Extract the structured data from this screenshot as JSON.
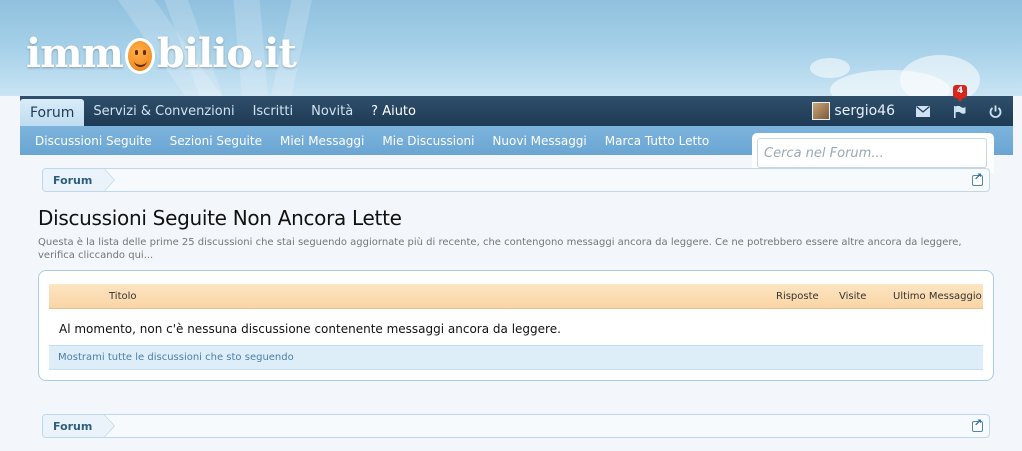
{
  "site": {
    "logo_text_left": "imm",
    "logo_text_right": "bilio.it",
    "brand_color": "#f07c10"
  },
  "nav": {
    "tabs": [
      {
        "label": "Forum",
        "active": true
      },
      {
        "label": "Servizi & Convenzioni"
      },
      {
        "label": "Iscritti"
      },
      {
        "label": "Novità"
      },
      {
        "label": "? Aiuto"
      }
    ],
    "user": "sergio46",
    "alerts_count": "4"
  },
  "subnav": {
    "links": [
      "Discussioni Seguite",
      "Sezioni Seguite",
      "Miei Messaggi",
      "Mie Discussioni",
      "Nuovi Messaggi",
      "Marca Tutto Letto"
    ]
  },
  "search": {
    "placeholder": "Cerca nel Forum..."
  },
  "breadcrumb": {
    "top": "Forum",
    "bottom": "Forum"
  },
  "page": {
    "title": "Discussioni Seguite Non Ancora Lette",
    "description": "Questa è la lista delle prime 25 discussioni che stai seguendo aggiornate più di recente, che contengono messaggi ancora da leggere. Ce ne potrebbero essere altre ancora da leggere, verifica cliccando qui..."
  },
  "table": {
    "columns": {
      "title": "Titolo",
      "replies": "Risposte",
      "views": "Visite",
      "last": "Ultimo Messaggio"
    },
    "empty_message": "Al momento, non c'è nessuna discussione contenente messaggi ancora da leggere.",
    "show_all_link": "Mostrami tutte le discussioni che sto seguendo"
  }
}
